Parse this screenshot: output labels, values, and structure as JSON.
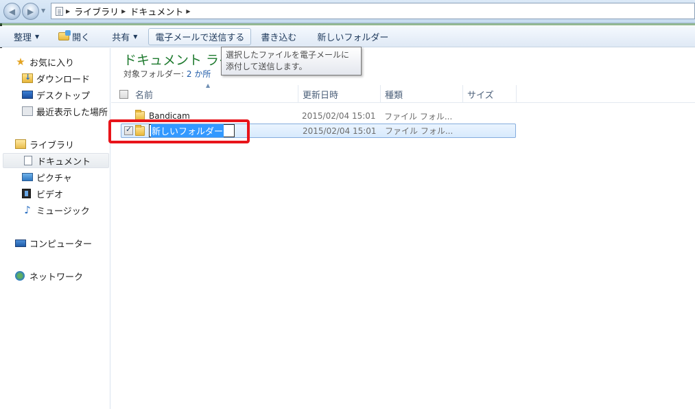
{
  "address": {
    "crumbs": [
      "ライブラリ",
      "ドキュメント"
    ]
  },
  "toolbar": {
    "organize": "整理",
    "open": "開く",
    "share": "共有",
    "email": "電子メールで送信する",
    "burn": "書き込む",
    "new_folder": "新しいフォルダー"
  },
  "tooltip": {
    "text": "選択したファイルを電子メールに添付して送信します。"
  },
  "nav": {
    "favorites": "お気に入り",
    "downloads": "ダウンロード",
    "desktop": "デスクトップ",
    "recent": "最近表示した場所",
    "libraries": "ライブラリ",
    "documents": "ドキュメント",
    "pictures": "ピクチャ",
    "videos": "ビデオ",
    "music": "ミュージック",
    "computer": "コンピューター",
    "network": "ネットワーク"
  },
  "library": {
    "title": "ドキュメント ライブラリ",
    "subtitle_label": "対象フォルダー:",
    "subtitle_link": "2 か所"
  },
  "columns": {
    "name": "名前",
    "date": "更新日時",
    "type": "種類",
    "size": "サイズ"
  },
  "rows": [
    {
      "name": "Bandicam",
      "date": "2015/02/04 15:01",
      "type": "ファイル フォル..."
    },
    {
      "name": "新しいフォルダー",
      "date": "2015/02/04 15:01",
      "type": "ファイル フォル..."
    }
  ],
  "colors": {
    "title_green": "#1e7a2e",
    "highlight_red": "#e8141a",
    "selection_blue": "#3399ff"
  }
}
